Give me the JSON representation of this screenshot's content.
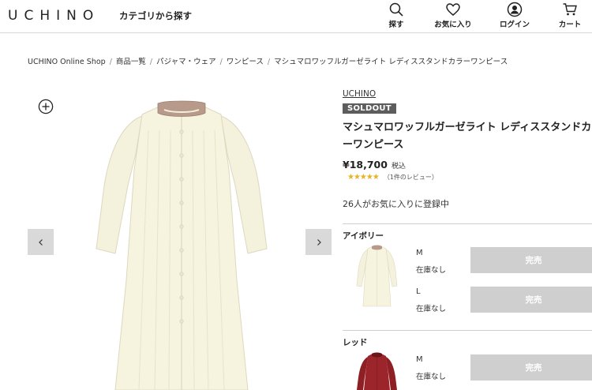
{
  "header": {
    "logo": "UCHINO",
    "category_link": "カテゴリから探す",
    "nav": [
      {
        "label": "探す",
        "icon": "search-icon"
      },
      {
        "label": "お気に入り",
        "icon": "heart-icon"
      },
      {
        "label": "ログイン",
        "icon": "user-icon"
      },
      {
        "label": "カート",
        "icon": "cart-icon"
      }
    ]
  },
  "breadcrumb": [
    "UCHINO Online Shop",
    "商品一覧",
    "パジャマ・ウェア",
    "ワンピース",
    "マシュマロワッフルガーゼライト レディススタンドカラーワンピース"
  ],
  "product": {
    "brand": "UCHINO",
    "badge": "SOLDOUT",
    "title": "マシュマロワッフルガーゼライト レディススタンドカラーワンピース",
    "price": "¥18,700",
    "tax_label": "税込",
    "stars": "★★★★★",
    "rating": 5,
    "review_count": "（1件のレビュー）",
    "favorites": "26人がお気に入りに登録中",
    "colors": [
      {
        "name": "アイボリー",
        "variants": [
          {
            "size": "M",
            "stock": "在庫なし",
            "button": "完売"
          },
          {
            "size": "L",
            "stock": "在庫なし",
            "button": "完売"
          }
        ]
      },
      {
        "name": "レッド",
        "variants": [
          {
            "size": "M",
            "stock": "在庫なし",
            "button": "完売"
          }
        ]
      }
    ]
  },
  "colors": {
    "soldout_badge": "#5d5d5d",
    "sold_button": "#cfcfcf",
    "star": "#e6b422",
    "ivory": "#f4f1dc",
    "collar": "#b89a8a",
    "red": "#8e1f24"
  }
}
